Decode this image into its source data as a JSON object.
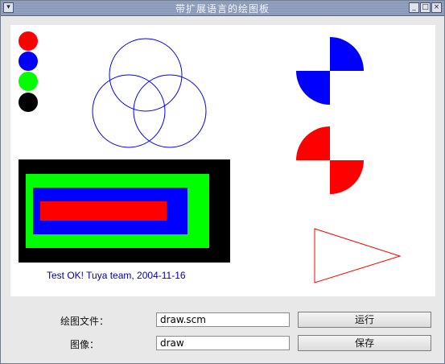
{
  "window": {
    "title": "带扩展语言的绘图板",
    "controls": {
      "minimize": "_",
      "maximize": "□",
      "close": "×"
    }
  },
  "canvas": {
    "caption": "Test OK! Tuya team, 2004-11-16",
    "colors": {
      "red": "#ff0000",
      "blue": "#0000ff",
      "green": "#00ff00",
      "black": "#000000",
      "caption": "#0000aa"
    }
  },
  "form": {
    "draw_file_label": "绘图文件：",
    "draw_file_value": "draw.scm",
    "run_button": "运行",
    "image_label": "图像：",
    "image_value": "draw",
    "save_button": "保存"
  }
}
